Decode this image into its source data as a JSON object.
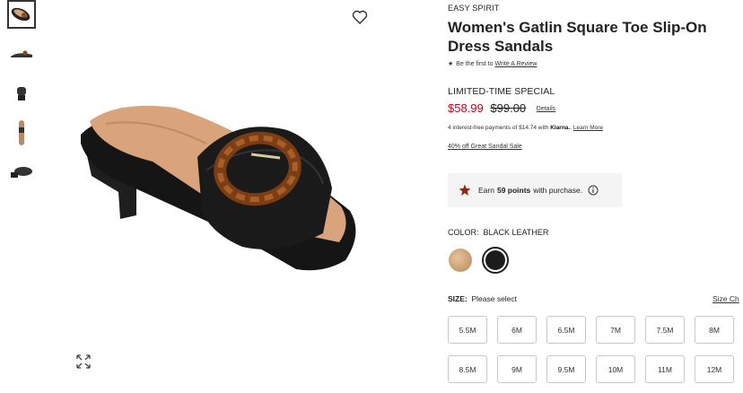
{
  "thumbnails": [
    {
      "icon": "sandal-top-view-thumb",
      "active": true
    },
    {
      "icon": "sandal-side-view-thumb",
      "active": false
    },
    {
      "icon": "sandal-front-view-thumb",
      "active": false
    },
    {
      "icon": "sandal-sole-view-thumb",
      "active": false
    },
    {
      "icon": "sandal-back-view-thumb",
      "active": false
    }
  ],
  "product": {
    "brand": "EASY SPIRIT",
    "title": "Women's Gatlin Square Toe Slip-On Dress Sandals",
    "review_prefix": "Be the first to",
    "review_link": "Write A Review",
    "promo_label": "LIMITED-TIME SPECIAL",
    "sale_price": "$58.99",
    "original_price": "$99.00",
    "details_link": "Details",
    "klarna_text": "4 interest-free payments of $14.74 with",
    "klarna_brand": "Klarna.",
    "klarna_link": "Learn More",
    "sale_link": "40% off Great Sandal Sale"
  },
  "points": {
    "prefix": "Earn",
    "amount": "59 points",
    "suffix": "with purchase."
  },
  "color": {
    "label": "COLOR:",
    "selected": "BLACK LEATHER",
    "swatches": [
      {
        "name": "natural",
        "color": "#c99a6a"
      },
      {
        "name": "black leather",
        "color": "#1c1c1c",
        "selected": true
      }
    ]
  },
  "size": {
    "label": "SIZE:",
    "prompt": "Please select",
    "chart_link": "Size Ch",
    "options": [
      "5.5M",
      "6M",
      "6.5M",
      "7M",
      "7.5M",
      "8M",
      "8.5M",
      "9M",
      "9.5M",
      "10M",
      "11M",
      "12M"
    ]
  },
  "colors": {
    "sale": "#d0021b",
    "star": "#8b2a14"
  }
}
